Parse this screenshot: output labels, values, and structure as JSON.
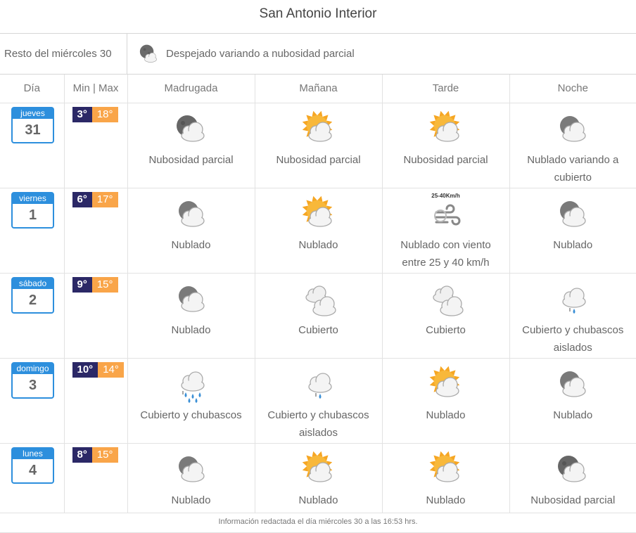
{
  "page_title": "San Antonio Interior",
  "resto": {
    "label": "Resto del miércoles 30",
    "icon": "moon-cloud-icon",
    "description": "Despejado variando a nubosidad parcial"
  },
  "headers": [
    "Día",
    "Min | Max",
    "Madrugada",
    "Mañana",
    "Tarde",
    "Noche"
  ],
  "days": [
    {
      "weekday": "jueves",
      "day": "31",
      "min": "3°",
      "max": "18°",
      "periods": [
        {
          "icon": "moon-cloud-icon",
          "desc": "Nubosidad parcial"
        },
        {
          "icon": "sun-cloud-icon",
          "desc": "Nubosidad parcial"
        },
        {
          "icon": "sun-cloud-icon",
          "desc": "Nubosidad parcial"
        },
        {
          "icon": "cloud-icon",
          "desc": "Nublado variando a cubierto"
        }
      ]
    },
    {
      "weekday": "viernes",
      "day": "1",
      "min": "6°",
      "max": "17°",
      "periods": [
        {
          "icon": "cloud-icon",
          "desc": "Nublado"
        },
        {
          "icon": "sun-cloud-icon",
          "desc": "Nublado"
        },
        {
          "icon": "wind-icon",
          "desc": "Nublado con viento entre 25 y 40 km/h",
          "extra": "25-40Km/h"
        },
        {
          "icon": "cloud-icon",
          "desc": "Nublado"
        }
      ]
    },
    {
      "weekday": "sábado",
      "day": "2",
      "min": "9°",
      "max": "15°",
      "periods": [
        {
          "icon": "cloud-icon",
          "desc": "Nublado"
        },
        {
          "icon": "overcast-icon",
          "desc": "Cubierto"
        },
        {
          "icon": "overcast-icon",
          "desc": "Cubierto"
        },
        {
          "icon": "light-shower-icon",
          "desc": "Cubierto y chubascos aislados"
        }
      ]
    },
    {
      "weekday": "domingo",
      "day": "3",
      "min": "10°",
      "max": "14°",
      "periods": [
        {
          "icon": "rain-showers-icon",
          "desc": "Cubierto y chubascos"
        },
        {
          "icon": "light-shower-icon",
          "desc": "Cubierto y chubascos aislados"
        },
        {
          "icon": "sun-cloud-icon",
          "desc": "Nublado"
        },
        {
          "icon": "cloud-icon",
          "desc": "Nublado"
        }
      ]
    },
    {
      "weekday": "lunes",
      "day": "4",
      "min": "8°",
      "max": "15°",
      "periods": [
        {
          "icon": "cloud-icon",
          "desc": "Nublado"
        },
        {
          "icon": "sun-cloud-icon",
          "desc": "Nublado"
        },
        {
          "icon": "sun-cloud-icon",
          "desc": "Nublado"
        },
        {
          "icon": "moon-cloud-icon",
          "desc": "Nubosidad parcial"
        }
      ]
    }
  ],
  "footer": "Información redactada el día miércoles 30 a las 16:53 hrs.",
  "colors": {
    "calendar_blue": "#2d8fdd",
    "min_temp_bg": "#2b2866",
    "max_temp_bg": "#f9a549",
    "sun": "#f6a623"
  }
}
